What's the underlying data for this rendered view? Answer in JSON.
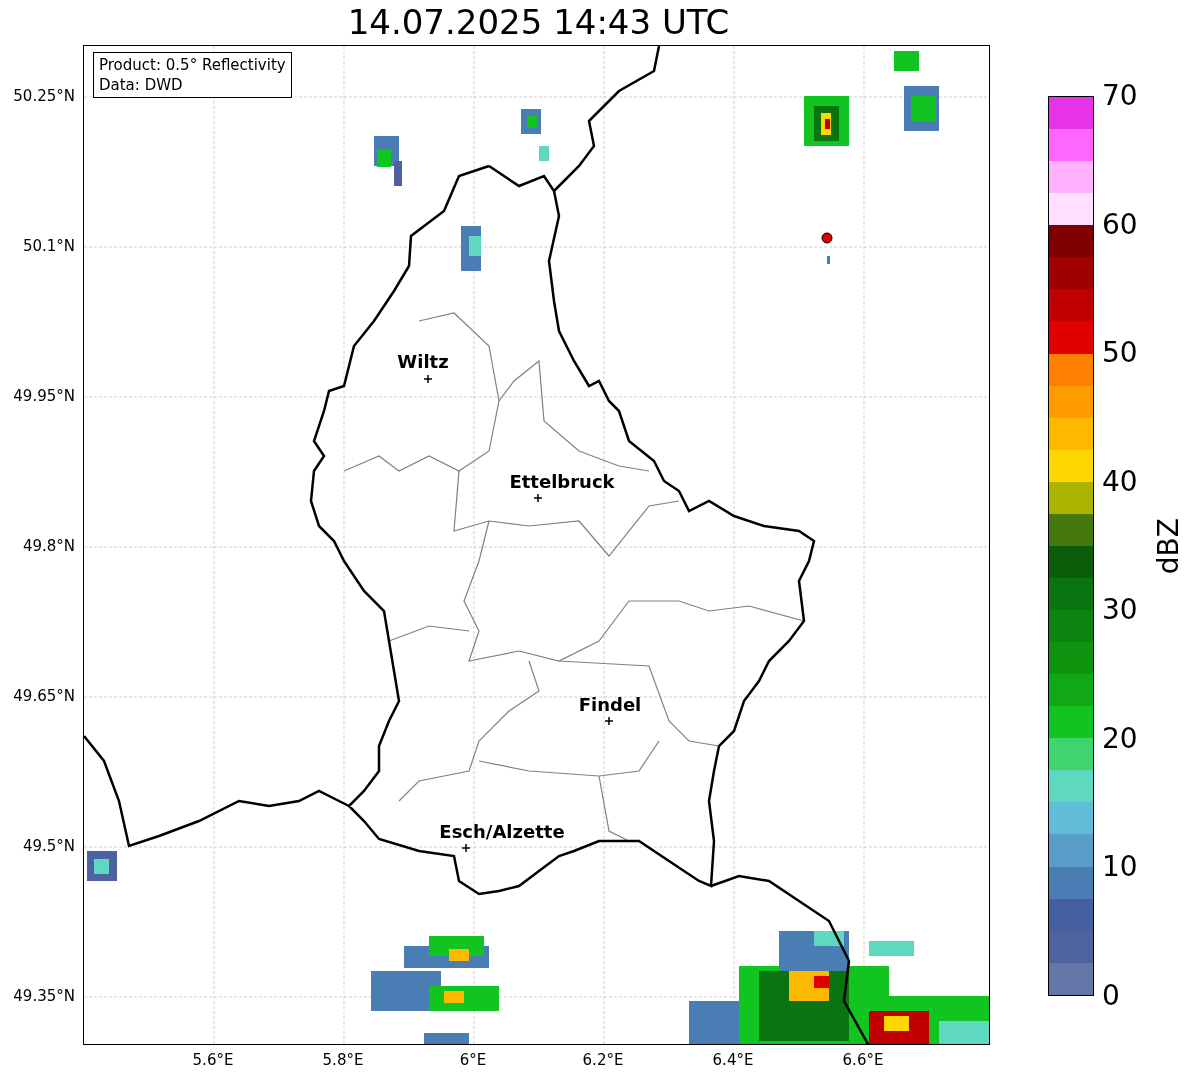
{
  "title": "14.07.2025 14:43 UTC",
  "info_box": {
    "lines": [
      "Product: 0.5° Reflectivity",
      "Data: DWD"
    ]
  },
  "y_ticks": [
    "50.25°N",
    "50.1°N",
    "49.95°N",
    "49.8°N",
    "49.65°N",
    "49.5°N",
    "49.35°N"
  ],
  "x_ticks": [
    "5.6°E",
    "5.8°E",
    "6°E",
    "6.2°E",
    "6.4°E",
    "6.6°E"
  ],
  "cities": [
    {
      "name": "Wiltz"
    },
    {
      "name": "Ettelbruck"
    },
    {
      "name": "Findel"
    },
    {
      "name": "Esch/Alzette"
    }
  ],
  "colorbar": {
    "label": "dBZ",
    "ticks": [
      "70",
      "60",
      "50",
      "40",
      "30",
      "20",
      "10",
      "0"
    ],
    "segments": [
      {
        "color": "#e733e7"
      },
      {
        "color": "#ff66ff"
      },
      {
        "color": "#ffb0ff"
      },
      {
        "color": "#ffe0ff"
      },
      {
        "color": "#7e0000"
      },
      {
        "color": "#a00000"
      },
      {
        "color": "#c00000"
      },
      {
        "color": "#e00000"
      },
      {
        "color": "#ff8000"
      },
      {
        "color": "#ff9d00"
      },
      {
        "color": "#ffb800"
      },
      {
        "color": "#ffd700"
      },
      {
        "color": "#aab400"
      },
      {
        "color": "#467810"
      },
      {
        "color": "#0a5e0a"
      },
      {
        "color": "#0a7410"
      },
      {
        "color": "#0c8410"
      },
      {
        "color": "#0f9410"
      },
      {
        "color": "#10a814"
      },
      {
        "color": "#12c420"
      },
      {
        "color": "#3fd46c"
      },
      {
        "color": "#5fd8c0"
      },
      {
        "color": "#60bcd8"
      },
      {
        "color": "#5a9dc8"
      },
      {
        "color": "#4a7db3"
      },
      {
        "color": "#445ea2"
      },
      {
        "color": "#4f62a0"
      },
      {
        "color": "#6475a8"
      }
    ]
  }
}
